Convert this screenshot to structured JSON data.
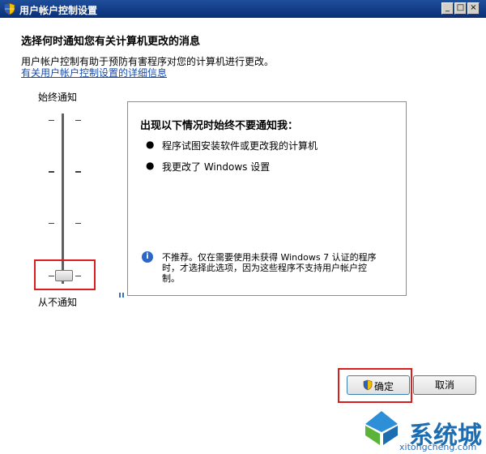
{
  "window": {
    "title": "用户帐户控制设置",
    "controls": {
      "minimize": "_",
      "maximize": "□",
      "close": "×"
    }
  },
  "main": {
    "heading": "选择何时通知您有关计算机更改的消息",
    "description_line1": "用户帐户控制有助于预防有害程序对您的计算机进行更改。",
    "description_link": "有关用户帐户控制设置的详细信息"
  },
  "slider": {
    "top_label": "始终通知",
    "bottom_label": "从不通知",
    "level": 0,
    "levels_count": 4
  },
  "info_panel": {
    "heading": "出现以下情况时始终不要通知我：",
    "bullets": [
      "程序试图安装软件或更改我的计算机",
      "我更改了 Windows 设置"
    ],
    "warning_line1": "不推荐。仅在需要使用未获得 Windows 7 认证的程序",
    "warning_line2": "时，才选择此选项，因为这些程序不支持用户帐户控",
    "warning_line3": "制。"
  },
  "buttons": {
    "ok": "确定",
    "cancel": "取消"
  },
  "watermark": {
    "brand": "系统城",
    "url": "xitongcheng.com"
  },
  "icons": {
    "title": "shield-icon",
    "ok": "shield-icon",
    "info": "info-icon",
    "logo": "logo-icon"
  },
  "colors": {
    "titlebar": "#0a2f78",
    "link": "#1a4ba8",
    "highlight_box": "#d81e1e",
    "info_icon": "#2a67c8"
  }
}
